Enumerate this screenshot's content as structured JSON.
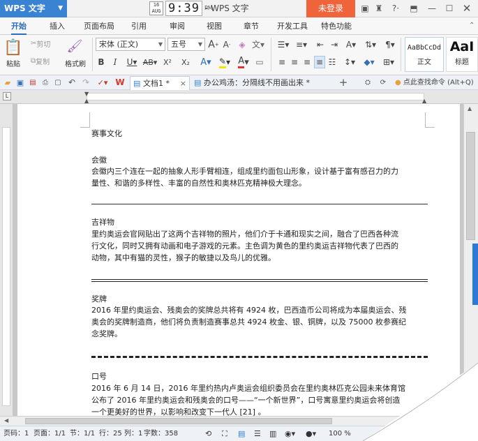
{
  "titlebar": {
    "app_button": "WPS 文字",
    "date_top": "16",
    "date_bottom": "AUG",
    "time": "9:39",
    "time_suffix": "PM",
    "window_title": "- WPS 文字",
    "login_button": "未登录"
  },
  "menu": [
    "开始",
    "插入",
    "页面布局",
    "引用",
    "审阅",
    "视图",
    "章节",
    "开发工具",
    "特色功能"
  ],
  "ribbon": {
    "paste": "粘贴",
    "cut": "剪切",
    "copy": "复制",
    "format_painter": "格式刷",
    "font_name": "宋体 (正文)",
    "font_size": "五号",
    "style_normal_preview": "AaBbCcDd",
    "style_normal": "正文",
    "style_heading_preview": "AaI",
    "style_heading": "标题"
  },
  "tabs": {
    "doc1": "文档1 *",
    "doc2": "办公鸡汤：分隔线不用画出来 *",
    "help_search": "点此查找命令 (Alt+Q)"
  },
  "document": {
    "title": "赛事文化",
    "sections": [
      {
        "heading": "会徽",
        "lines": [
          "会徽内三个连在一起的抽象人形手臂相连，组成里约面包山形象，设计基于富有感召力的力",
          "量性、和谐的多样性、丰富的自然性和奥林匹克精神极大理念。"
        ]
      },
      {
        "heading": "吉祥物",
        "lines": [
          "里约奥运会官网贴出了这两个吉祥物的照片，他们介于卡通和现实之间，融合了巴西各种流",
          "行文化，同时又拥有动画和电子游戏的元素。主色调为黄色的里约奥运吉祥物代表了巴西的",
          "动物，其中有猫的灵性，猴子的敏捷以及鸟儿的优雅。"
        ]
      },
      {
        "heading": "奖牌",
        "lines": [
          "2016 年里约奥运会、残奥会的奖牌总共将有 4924 枚，巴西造币公司将成为本届奥运会、残",
          "奥会的奖牌制造商，他们将负责制造赛事总共 4924 枚金、银、铜牌，以及 75000 枚参赛纪",
          "念奖牌。"
        ]
      },
      {
        "heading": "口号",
        "lines": [
          "2016 年 6 月 14 日，2016 年里约热内卢奥运会组织委员会在里约奥林匹克公园未来体育馆",
          "公布了 2016 年里约奥运会和残奥会的口号——“一个新世界”，口号寓意里约奥运会将创造",
          "一个更美好的世界，以影响和改变下一代人 [21] 。"
        ]
      }
    ]
  },
  "status": {
    "page": "页码：1",
    "pages": "页面：1/1",
    "section": "节：1/1",
    "row": "行：25",
    "col": "列：1",
    "words": "字数：358",
    "zoom": "100 %"
  },
  "colors": {
    "accent": "#3a83d2",
    "login": "#f0643c",
    "scroll_mark": "#2c7ad6"
  }
}
